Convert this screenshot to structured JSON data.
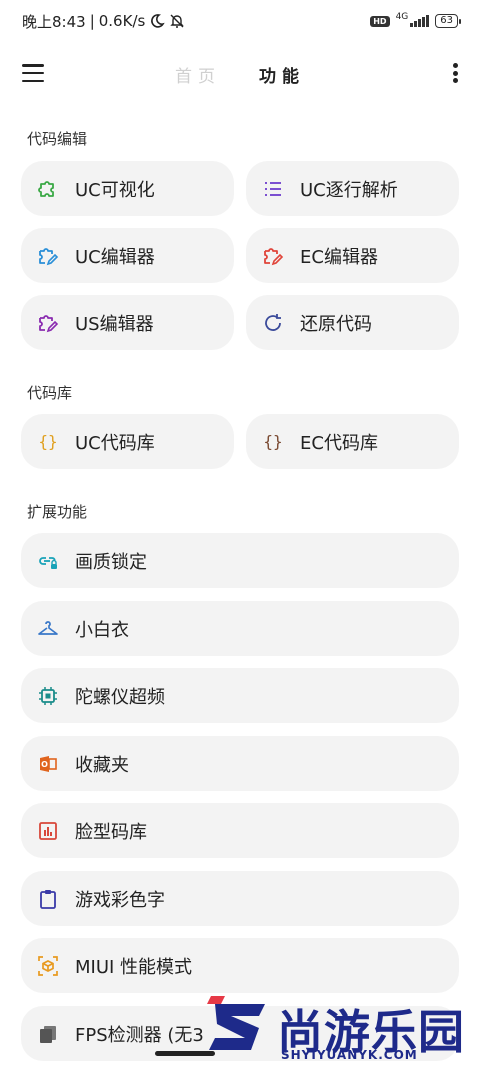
{
  "status": {
    "time": "晚上8:43",
    "separator": "|",
    "speed": "0.6K/s",
    "hd": "HD",
    "network": "4G",
    "battery": "63"
  },
  "appbar": {
    "tabs": [
      {
        "label": "首页",
        "active": false
      },
      {
        "label": "功能",
        "active": true
      }
    ]
  },
  "sections": {
    "code_edit": {
      "title": "代码编辑",
      "items": [
        {
          "label": "UC可视化",
          "icon": "puzzle-icon",
          "color": "#3aa845"
        },
        {
          "label": "UC逐行解析",
          "icon": "list-icon",
          "color": "#7b4fd1"
        },
        {
          "label": "UC编辑器",
          "icon": "puzzle-edit-icon",
          "color": "#2a8fd8"
        },
        {
          "label": "EC编辑器",
          "icon": "puzzle-edit-icon",
          "color": "#e0443a"
        },
        {
          "label": "US编辑器",
          "icon": "puzzle-edit-icon",
          "color": "#8a2bb0"
        },
        {
          "label": "还原代码",
          "icon": "restore-icon",
          "color": "#3a4a9a"
        }
      ]
    },
    "code_lib": {
      "title": "代码库",
      "items": [
        {
          "label": "UC代码库",
          "icon": "braces-icon",
          "color": "#e0a020"
        },
        {
          "label": "EC代码库",
          "icon": "braces-icon",
          "color": "#7a4a32"
        }
      ]
    },
    "extensions": {
      "title": "扩展功能",
      "items": [
        {
          "label": "画质锁定",
          "icon": "link-lock-icon",
          "color": "#19a3b8"
        },
        {
          "label": "小白衣",
          "icon": "hanger-icon",
          "color": "#3a78c8"
        },
        {
          "label": "陀螺仪超频",
          "icon": "chip-icon",
          "color": "#1a8c8a"
        },
        {
          "label": "收藏夹",
          "icon": "office-icon",
          "color": "#e0641e"
        },
        {
          "label": "脸型码库",
          "icon": "chart-icon",
          "color": "#d8473a"
        },
        {
          "label": "游戏彩色字",
          "icon": "clipboard-icon",
          "color": "#3a3aa8"
        },
        {
          "label": "MIUI 性能模式",
          "icon": "cube-scan-icon",
          "color": "#e89a20"
        },
        {
          "label": "FPS检测器 (无3",
          "icon": "copy-icon",
          "color": "#555555"
        }
      ]
    }
  },
  "watermark": {
    "text": "尚游乐园",
    "sub": "SHYIYUANYK.COM"
  }
}
